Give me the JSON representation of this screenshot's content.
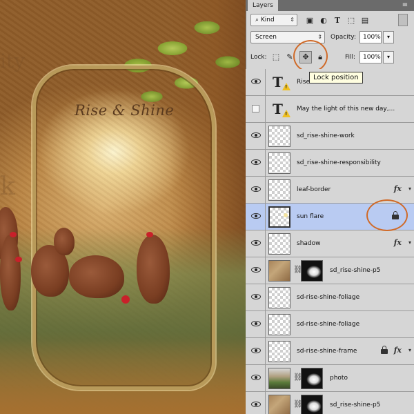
{
  "panel": {
    "tab_label": "Layers",
    "filter_kind": "Kind",
    "blend_mode": "Screen",
    "opacity_label": "Opacity:",
    "opacity_value": "100%",
    "lock_label": "Lock:",
    "fill_label": "Fill:",
    "fill_value": "100%",
    "tooltip": "Lock position"
  },
  "canvas": {
    "title_text": "Rise & Shine",
    "ghost_text_top": "ity",
    "ghost_text_left": "k"
  },
  "layers": [
    {
      "name": "Rise & Shine",
      "type": "text",
      "visible": true,
      "warning": true
    },
    {
      "name": "May the light of  this new day,...",
      "type": "text",
      "visible": false,
      "warning": true
    },
    {
      "name": "sd_rise-shine-work",
      "type": "pixel",
      "visible": true
    },
    {
      "name": "sd_rise-shine-responsibility",
      "type": "pixel",
      "visible": true
    },
    {
      "name": "leaf-border",
      "type": "pixel",
      "visible": true,
      "fx": true
    },
    {
      "name": "sun flare",
      "type": "pixel",
      "visible": true,
      "selected": true,
      "locked": true
    },
    {
      "name": "shadow",
      "type": "pixel",
      "visible": true,
      "fx": true
    },
    {
      "name": "sd_rise-shine-p5",
      "type": "masked",
      "visible": true
    },
    {
      "name": "sd-rise-shine-foliage",
      "type": "pixel",
      "visible": true
    },
    {
      "name": "sd-rise-shine-foliage",
      "type": "pixel",
      "visible": true
    },
    {
      "name": "sd-rise-shine-frame",
      "type": "pixel",
      "visible": true,
      "fx": true,
      "locked": true
    },
    {
      "name": "photo",
      "type": "masked",
      "visible": true
    },
    {
      "name": "sd_rise-shine-p5",
      "type": "masked",
      "visible": true
    }
  ],
  "icons": {
    "fx_label": "fx",
    "colors": {
      "highlight": "#b9cbf2",
      "ring": "#d06a28",
      "panel_bg": "#d6d6d6"
    }
  }
}
